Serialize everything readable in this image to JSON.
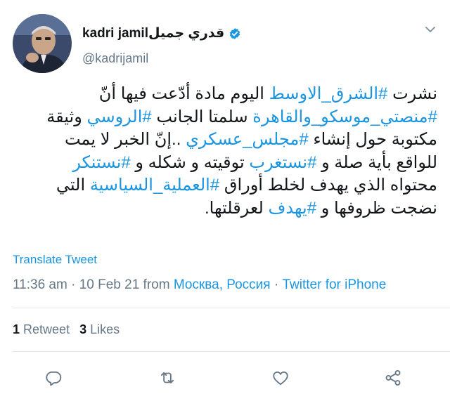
{
  "user": {
    "display_name": "kadri jamilقدري جميل",
    "handle": "@kadrijamil",
    "verified": true
  },
  "tweet": {
    "lines": [
      [
        {
          "text": "نشرت ",
          "tag": false
        },
        {
          "text": "#الشرق_الاوسط",
          "tag": true
        },
        {
          "text": " اليوم مادة أدّعت فيها أنّ",
          "tag": false
        }
      ],
      [
        {
          "text": "#منصتي_موسكو_والقاهرة",
          "tag": true
        },
        {
          "text": " سلمتا الجانب ",
          "tag": false
        },
        {
          "text": "#الروسي",
          "tag": true
        },
        {
          "text": " وثيقة",
          "tag": false
        }
      ],
      [
        {
          "text": "مكتوبة حول إنشاء ",
          "tag": false
        },
        {
          "text": "#مجلس_عسكري",
          "tag": true
        },
        {
          "text": " ..إنّ الخبر لا يمت",
          "tag": false
        }
      ],
      [
        {
          "text": "للواقع بأية صلة و ",
          "tag": false
        },
        {
          "text": "#نستغرب",
          "tag": true
        },
        {
          "text": " توقيته و شكله و ",
          "tag": false
        },
        {
          "text": "#نستنكر",
          "tag": true
        }
      ],
      [
        {
          "text": "محتواه الذي يهدف لخلط أوراق ",
          "tag": false
        },
        {
          "text": "#العملية_السياسية",
          "tag": true
        },
        {
          "text": " التي",
          "tag": false
        }
      ],
      [
        {
          "text": "نضجت ظروفها و ",
          "tag": false
        },
        {
          "text": "#يهدف",
          "tag": true
        },
        {
          "text": " لعرقلتها.",
          "tag": false
        }
      ]
    ],
    "translate_label": "Translate Tweet",
    "time": "11:36 am",
    "sep1": " · ",
    "date": "10 Feb 21",
    "from_text": " from ",
    "location": "Москва, Россия",
    "sep2": " · ",
    "source": "Twitter for iPhone"
  },
  "stats": {
    "retweets_count": "1",
    "retweets_label": "Retweet",
    "likes_count": "3",
    "likes_label": "Likes"
  },
  "icons": {
    "reply": "reply-icon",
    "retweet": "retweet-icon",
    "like": "heart-icon",
    "share": "share-icon",
    "verified": "verified-badge-icon",
    "menu": "chevron-down-icon"
  },
  "colors": {
    "link": "#1b95e0",
    "text": "#14171a",
    "muted": "#657786",
    "divider": "#e1e8ed"
  }
}
